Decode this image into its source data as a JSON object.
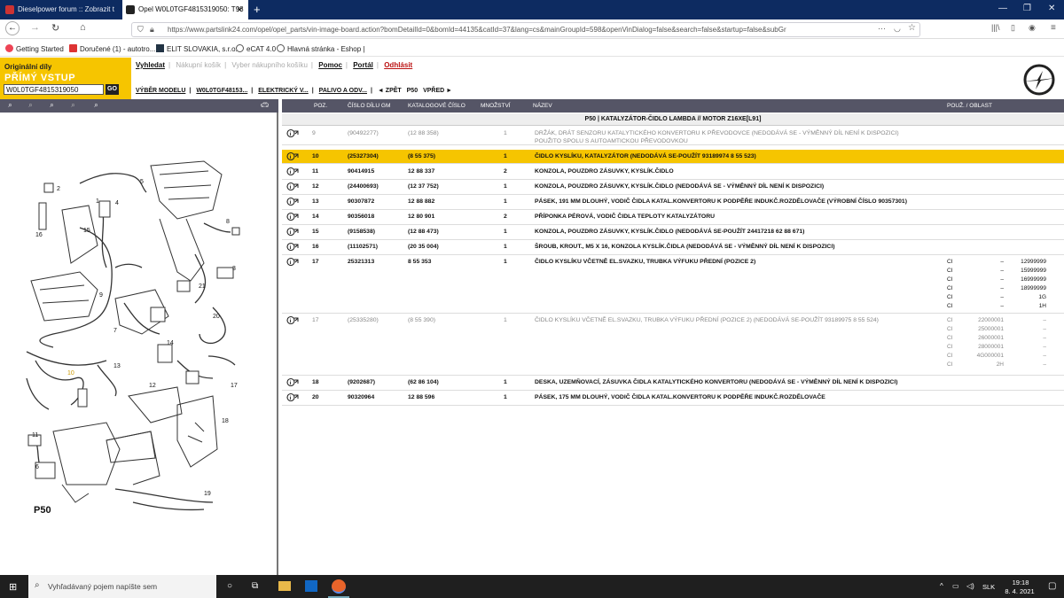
{
  "browser": {
    "tabs": [
      {
        "title": "Dieselpower forum :: Zobrazit t"
      },
      {
        "title": "Opel W0L0TGF4815319050: T98"
      }
    ],
    "url": "https://www.partslink24.com/opel/opel_parts/vin-image-board.action?bomDetailId=0&bomId=44135&catId=37&lang=cs&mainGroupId=598&openVinDialog=false&search=false&startup=false&subGr",
    "bookmarks": [
      "Getting Started",
      "Doručené (1) - autotro...",
      "ELIT SLOVAKIA, s.r.o.",
      "eCAT 4.0",
      "Hlavná stránka - Eshop |"
    ]
  },
  "brand": {
    "subtitle": "Originální díly",
    "title": "PŘÍMÝ VSTUP",
    "vin": "W0L0TGF4815319050",
    "go": "GO"
  },
  "topnav": [
    "Vyhledat",
    "Nákupní košík",
    "Vyber nákupního košíku",
    "Pomoc",
    "Portál",
    "Odhlásit"
  ],
  "crumbs": [
    "VÝBĚR MODELU",
    "W0L0TGF48153...",
    "ELEKTRICKÝ V...",
    "PALIVO A ODV...",
    "◄ ZPĚT",
    "P50",
    "VPŘED ►"
  ],
  "diagram": {
    "label": "P50",
    "callouts": [
      "2",
      "5",
      "4",
      "1",
      "16",
      "15",
      "8",
      "3",
      "21",
      "9",
      "7",
      "20",
      "6",
      "14",
      "10",
      "13",
      "12",
      "17",
      "18",
      "11",
      "6",
      "19"
    ]
  },
  "table": {
    "headers": [
      "POZ.",
      "ČÍSLO DÍLU GM",
      "KATALOGOVÉ ČÍSLO",
      "MNOŽSTVÍ",
      "NÁZEV",
      "POUŽ. / OBLAST"
    ],
    "group": "P50 | KATALYZÁTOR-ČIDLO LAMBDA // MOTOR Z16XE[L91]",
    "rows": [
      {
        "pos": "9",
        "gm": "(90492277)",
        "cat": "(12 88 358)",
        "qty": "1",
        "name": "DRŽÁK, DRÁT SENZORU KATALYTICKÉHO KONVERTORU K PŘEVODOVCE (NEDODÁVÁ SE - VÝMĚNNÝ DÍL NENÍ K DISPOZICI)",
        "note": "POUŽITO SPOLU S AUTOAMTICKOU PŘEVODOVKOU"
      },
      {
        "pos": "10",
        "gm": "(25327304)",
        "cat": "(8 55 375)",
        "qty": "1",
        "name": "ČIDLO KYSLÍKU, KATALYZÁTOR (NEDODÁVÁ SE-POUŽÍT 93189974 8 55 523)"
      },
      {
        "pos": "11",
        "gm": "90414915",
        "cat": "12 88 337",
        "qty": "2",
        "name": "KONZOLA, POUZDRO ZÁSUVKY, KYSLÍK.ČIDLO"
      },
      {
        "pos": "12",
        "gm": "(24400693)",
        "cat": "(12 37 752)",
        "qty": "1",
        "name": "KONZOLA, POUZDRO ZÁSUVKY, KYSLÍK.ČIDLO (NEDODÁVÁ SE - VÝMĚNNÝ DÍL NENÍ K DISPOZICI)"
      },
      {
        "pos": "13",
        "gm": "90307872",
        "cat": "12 88 882",
        "qty": "1",
        "name": "PÁSEK, 191 MM DLOUHÝ, VODIČ ČIDLA KATAL.KONVERTORU K PODPĚŘE INDUKČ.ROZDĚLOVAČE (VÝROBNÍ ČÍSLO 90357301)"
      },
      {
        "pos": "14",
        "gm": "90356018",
        "cat": "12 80 901",
        "qty": "2",
        "name": "PŘÍPONKA PÉROVÁ, VODIČ ČIDLA TEPLOTY KATALYZÁTORU"
      },
      {
        "pos": "15",
        "gm": "(9158538)",
        "cat": "(12 88 473)",
        "qty": "1",
        "name": "KONZOLA, POUZDRO ZÁSUVKY, KYSLÍK.ČIDLO (NEDODÁVÁ SE-POUŽÍT 24417218 62 88 671)"
      },
      {
        "pos": "16",
        "gm": "(11102571)",
        "cat": "(20 35 004)",
        "qty": "1",
        "name": "ŠROUB, KROUT., M5 X 16, KONZOLA KYSLÍK.ČIDLA (NEDODÁVÁ SE - VÝMĚNNÝ DÍL NENÍ K DISPOZICI)"
      },
      {
        "pos": "17",
        "gm": "25321313",
        "cat": "8 55 353",
        "qty": "1",
        "name": "ČIDLO KYSLÍKU VČETNĚ EL.SVAZKU, TRUBKA VÝFUKU PŘEDNÍ (POZICE 2)",
        "areas": [
          [
            "CI",
            "–",
            "12999999"
          ],
          [
            "CI",
            "–",
            "15999999"
          ],
          [
            "CI",
            "–",
            "16999999"
          ],
          [
            "CI",
            "–",
            "18999999"
          ],
          [
            "CI",
            "–",
            "1G"
          ],
          [
            "CI",
            "–",
            "1H"
          ]
        ]
      },
      {
        "pos": "17",
        "gm": "(25335280)",
        "cat": "(8 55 390)",
        "qty": "1",
        "name": "ČIDLO KYSLÍKU VČETNĚ EL.SVAZKU, TRUBKA VÝFUKU PŘEDNÍ (POZICE 2) (NEDODÁVÁ SE-POUŽÍT 93189975 8 55 524)",
        "areas": [
          [
            "CI",
            "22000001",
            "–"
          ],
          [
            "CI",
            "25000001",
            "–"
          ],
          [
            "CI",
            "26000001",
            "–"
          ],
          [
            "CI",
            "28000001",
            "–"
          ],
          [
            "CI",
            "4G000001",
            "–"
          ],
          [
            "CI",
            "2H",
            "–"
          ]
        ]
      },
      {
        "pos": "18",
        "gm": "(9202687)",
        "cat": "(62 86 104)",
        "qty": "1",
        "name": "DESKA, UZEMŇOVACÍ, ZÁSUVKA ČIDLA KATALYTICKÉHO KONVERTORU (NEDODÁVÁ SE - VÝMĚNNÝ DÍL NENÍ K DISPOZICI)"
      },
      {
        "pos": "20",
        "gm": "90320964",
        "cat": "12 88 596",
        "qty": "1",
        "name": "PÁSEK, 175 MM DLOUHÝ, VODIČ ČIDLA KATAL.KONVERTORU K PODPĚŘE INDUKČ.ROZDĚLOVAČE"
      }
    ]
  },
  "taskbar": {
    "search_placeholder": "Vyhľadávaný pojem napíšte sem",
    "lang": "SLK",
    "time": "19:18",
    "date": "8. 4. 2021"
  },
  "colors": {
    "accent": "#f6c500",
    "header_bg": "#556",
    "tabbar": "#0d2b61"
  }
}
